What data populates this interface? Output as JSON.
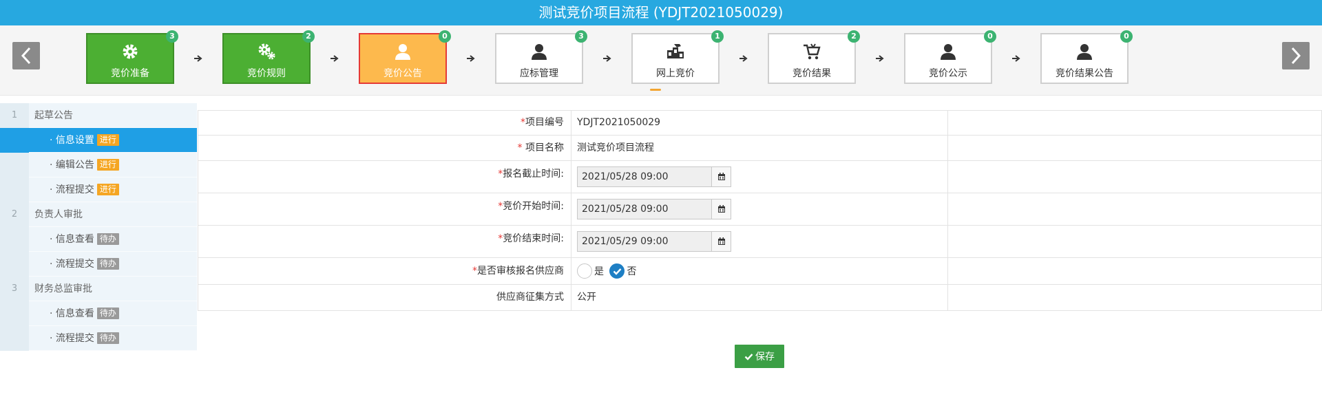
{
  "title": "测试竞价项目流程 (YDJT2021050029)",
  "steps": [
    {
      "label": "竞价准备",
      "badge": "3",
      "icon": "gear-icon",
      "state": "done"
    },
    {
      "label": "竞价规则",
      "badge": "2",
      "icon": "gears-icon",
      "state": "done"
    },
    {
      "label": "竞价公告",
      "badge": "0",
      "icon": "user-icon",
      "state": "active"
    },
    {
      "label": "应标管理",
      "badge": "3",
      "icon": "user-icon",
      "state": "normal"
    },
    {
      "label": "网上竞价",
      "badge": "1",
      "icon": "bidding-icon",
      "state": "normal"
    },
    {
      "label": "竞价结果",
      "badge": "2",
      "icon": "cart-icon",
      "state": "normal"
    },
    {
      "label": "竞价公示",
      "badge": "0",
      "icon": "user-icon",
      "state": "normal"
    },
    {
      "label": "竞价结果公告",
      "badge": "0",
      "icon": "user-icon",
      "state": "normal"
    }
  ],
  "sidebar": {
    "groups": [
      {
        "num": "1",
        "title": "起草公告",
        "items": [
          {
            "label": "· 信息设置",
            "tag": "进行"
          },
          {
            "label": "· 编辑公告",
            "tag": "进行"
          },
          {
            "label": "· 流程提交",
            "tag": "进行"
          }
        ]
      },
      {
        "num": "2",
        "title": "负责人审批",
        "items": [
          {
            "label": "· 信息查看",
            "tag": "待办"
          },
          {
            "label": "· 流程提交",
            "tag": "待办"
          }
        ]
      },
      {
        "num": "3",
        "title": "财务总监审批",
        "items": [
          {
            "label": "· 信息查看",
            "tag": "待办"
          },
          {
            "label": "· 流程提交",
            "tag": "待办"
          }
        ]
      }
    ]
  },
  "form": {
    "project_no_label": "项目编号",
    "project_no": "YDJT2021050029",
    "project_name_label": " 项目名称",
    "project_name": "测试竞价项目流程",
    "reg_deadline_label": "报名截止时间:",
    "reg_deadline": "2021/05/28 09:00",
    "bid_start_label": "竞价开始时间:",
    "bid_start": "2021/05/28 09:00",
    "bid_end_label": "竞价结束时间:",
    "bid_end": "2021/05/29 09:00",
    "review_label": "是否审核报名供应商",
    "review_yes": "是",
    "review_no": "否",
    "collect_label": "供应商征集方式",
    "collect_value": "公开"
  },
  "save_label": "保存",
  "colors": {
    "header": "#27a8e0",
    "done": "#4caf33",
    "active": "#fdb94d",
    "selected": "#1f9fe5",
    "save": "#3b9f45"
  }
}
